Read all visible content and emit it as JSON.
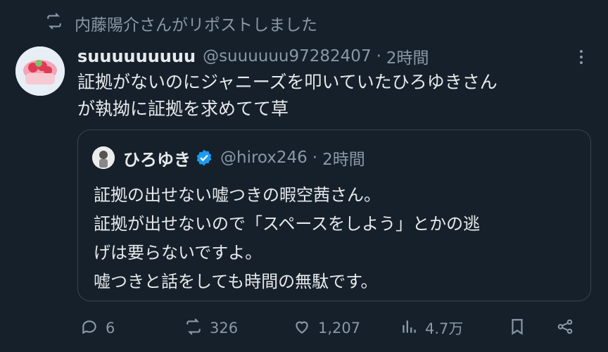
{
  "repost_banner": {
    "text": "内藤陽介さんがリポストしました"
  },
  "tweet": {
    "author_name": "suuuuuuuuu",
    "author_handle": "@suuuuuu97282407",
    "separator": "·",
    "time": "2時間",
    "text_lines": [
      "証拠がないのにジャニーズを叩いていたひろゆきさん",
      "が執拗に証拠を求めてて草"
    ]
  },
  "quote": {
    "author_name": "ひろゆき",
    "author_handle": "@hirox246",
    "separator": "·",
    "time": "2時間",
    "text_lines": [
      "証拠の出せない嘘つきの暇空茜さん。",
      "証拠が出せないので「スペースをしよう」とかの逃",
      "げは要らないですよ。",
      "嘘つきと話をしても時間の無駄です。"
    ]
  },
  "actions": {
    "replies": "6",
    "reposts": "326",
    "likes": "1,207",
    "views": "4.7万"
  },
  "colors": {
    "background": "#15202b",
    "text": "#e7e9ea",
    "muted": "#8b98a5",
    "border": "#38444d",
    "verified": "#1d9bf0"
  },
  "icons": [
    "repost-icon",
    "more-icon",
    "verified-icon",
    "reply-icon",
    "like-icon",
    "views-icon",
    "bookmark-icon",
    "share-icon"
  ]
}
